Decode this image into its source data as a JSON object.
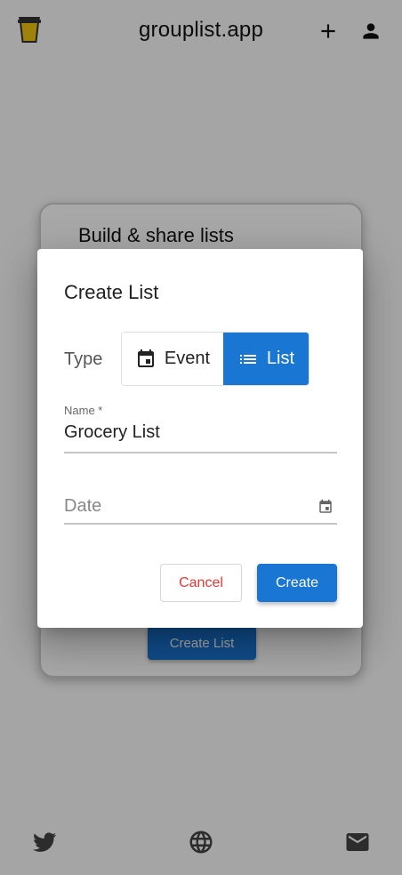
{
  "header": {
    "title": "grouplist.app",
    "icons": {
      "logo": "cup-logo-icon",
      "add": "plus-icon",
      "account": "user-icon"
    }
  },
  "card": {
    "title": "Build & share lists",
    "create_button": "Create List"
  },
  "footer": {
    "icons": [
      "twitter-icon",
      "globe-icon",
      "mail-icon"
    ]
  },
  "dialog": {
    "title": "Create List",
    "type_label": "Type",
    "type_options": [
      {
        "label": "Event",
        "icon": "calendar-icon",
        "selected": false
      },
      {
        "label": "List",
        "icon": "list-icon",
        "selected": true
      }
    ],
    "name_field": {
      "label": "Name *",
      "value": "Grocery List"
    },
    "date_field": {
      "placeholder": "Date",
      "icon": "calendar-icon"
    },
    "cancel_label": "Cancel",
    "create_label": "Create"
  },
  "colors": {
    "primary": "#1976d2",
    "cancel_text": "#e53935",
    "logo_cup": "#f2c511"
  }
}
